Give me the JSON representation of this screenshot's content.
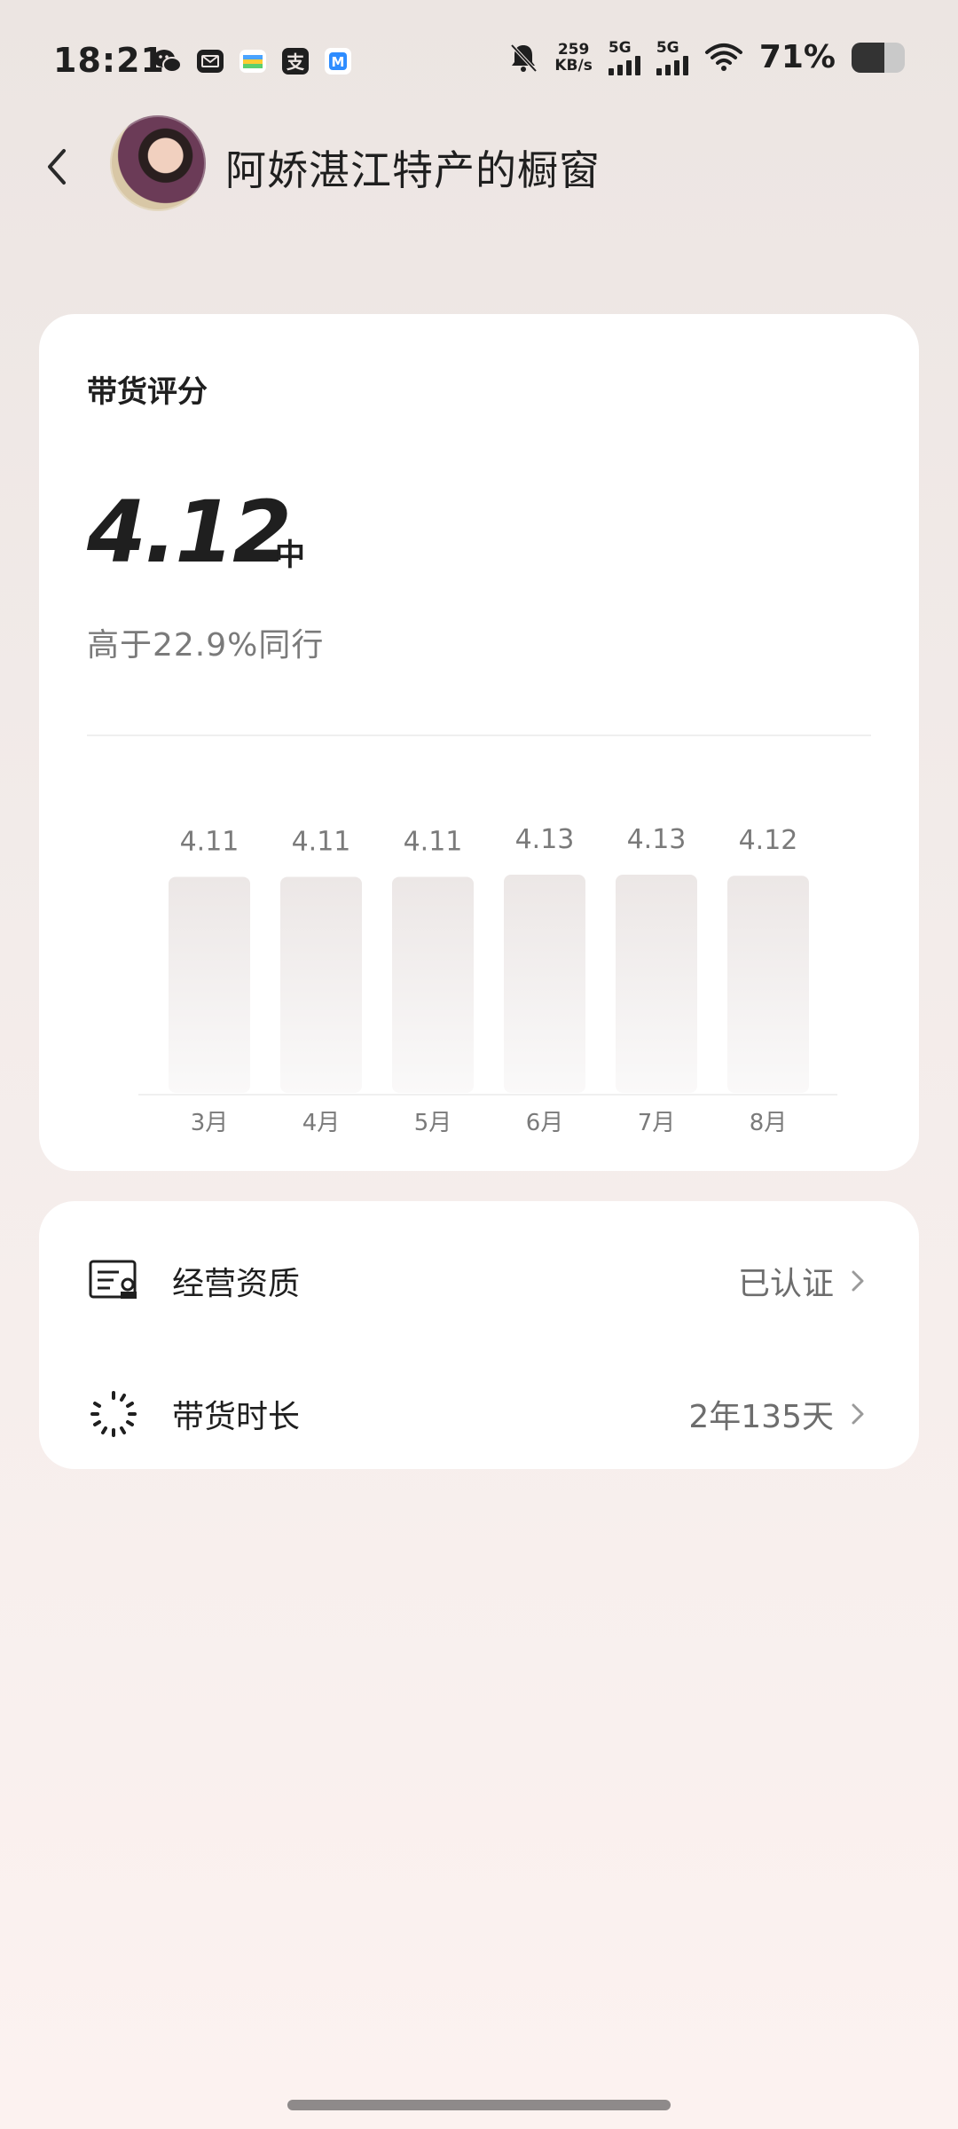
{
  "status_bar": {
    "time": "18:21",
    "net_speed_top": "259",
    "net_speed_bottom": "KB/s",
    "signal1_label": "5G",
    "signal2_label": "5G",
    "battery": "71%"
  },
  "header": {
    "title": "阿娇湛江特产的橱窗"
  },
  "score_card": {
    "label": "带货评分",
    "value": "4.12",
    "level": "中",
    "peer_text": "高于22.9%同行"
  },
  "chart_data": {
    "type": "bar",
    "categories": [
      "3月",
      "4月",
      "5月",
      "6月",
      "7月",
      "8月"
    ],
    "values": [
      4.11,
      4.11,
      4.11,
      4.13,
      4.13,
      4.12
    ],
    "value_labels": [
      "4.11",
      "4.11",
      "4.11",
      "4.13",
      "4.13",
      "4.12"
    ]
  },
  "info_card": {
    "rows": [
      {
        "label": "经营资质",
        "value": "已认证",
        "icon": "license-icon"
      },
      {
        "label": "带货时长",
        "value": "2年135天",
        "icon": "loading-ring-icon"
      }
    ]
  },
  "colors": {
    "bar_top": "#ece7e6",
    "bar_bottom": "#faf9f9",
    "text_muted": "#7a7a7a"
  }
}
